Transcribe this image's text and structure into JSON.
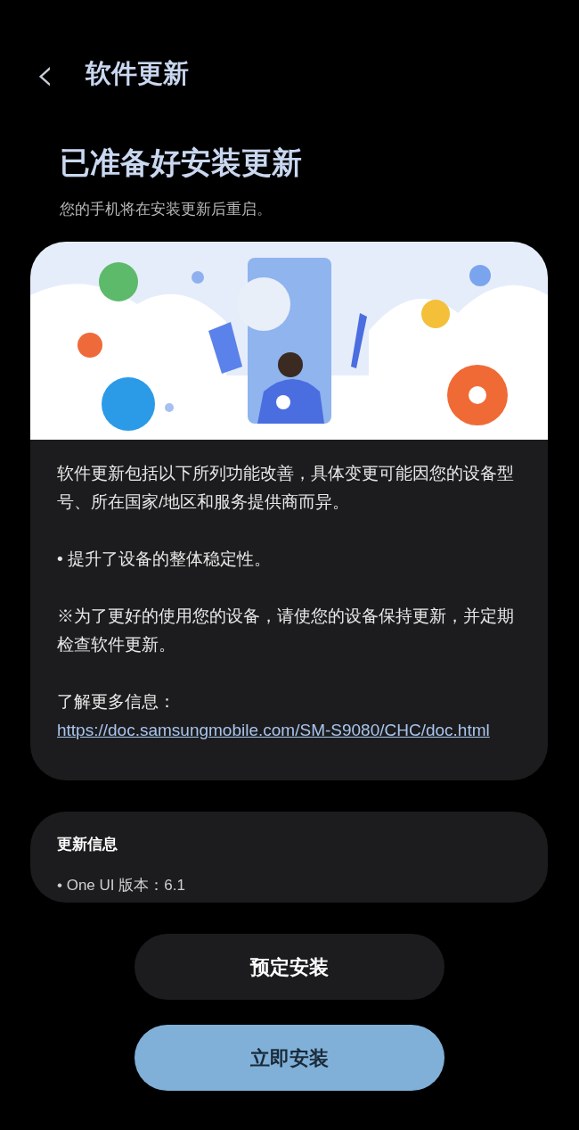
{
  "header": {
    "back_icon": "‹",
    "title": "软件更新"
  },
  "heading": "已准备好安装更新",
  "subtitle": "您的手机将在安装更新后重启。",
  "release_notes": {
    "paragraphs": [
      "软件更新包括以下所列功能改善，具体变更可能因您的设备型号、所在国家/地区和服务提供商而异。",
      "• 提升了设备的整体稳定性。",
      "※为了更好的使用您的设备，请使您的设备保持更新，并定期检查软件更新。"
    ],
    "more_info_label": "了解更多信息：",
    "link": "https://doc.samsungmobile.com/SM-S9080/CHC/doc.html"
  },
  "update_info": {
    "title": "更新信息",
    "items": [
      "• One UI 版本：6.1"
    ]
  },
  "buttons": [
    {
      "label": "预定安装",
      "kind": "secondary"
    },
    {
      "label": "立即安装",
      "kind": "primary"
    }
  ]
}
